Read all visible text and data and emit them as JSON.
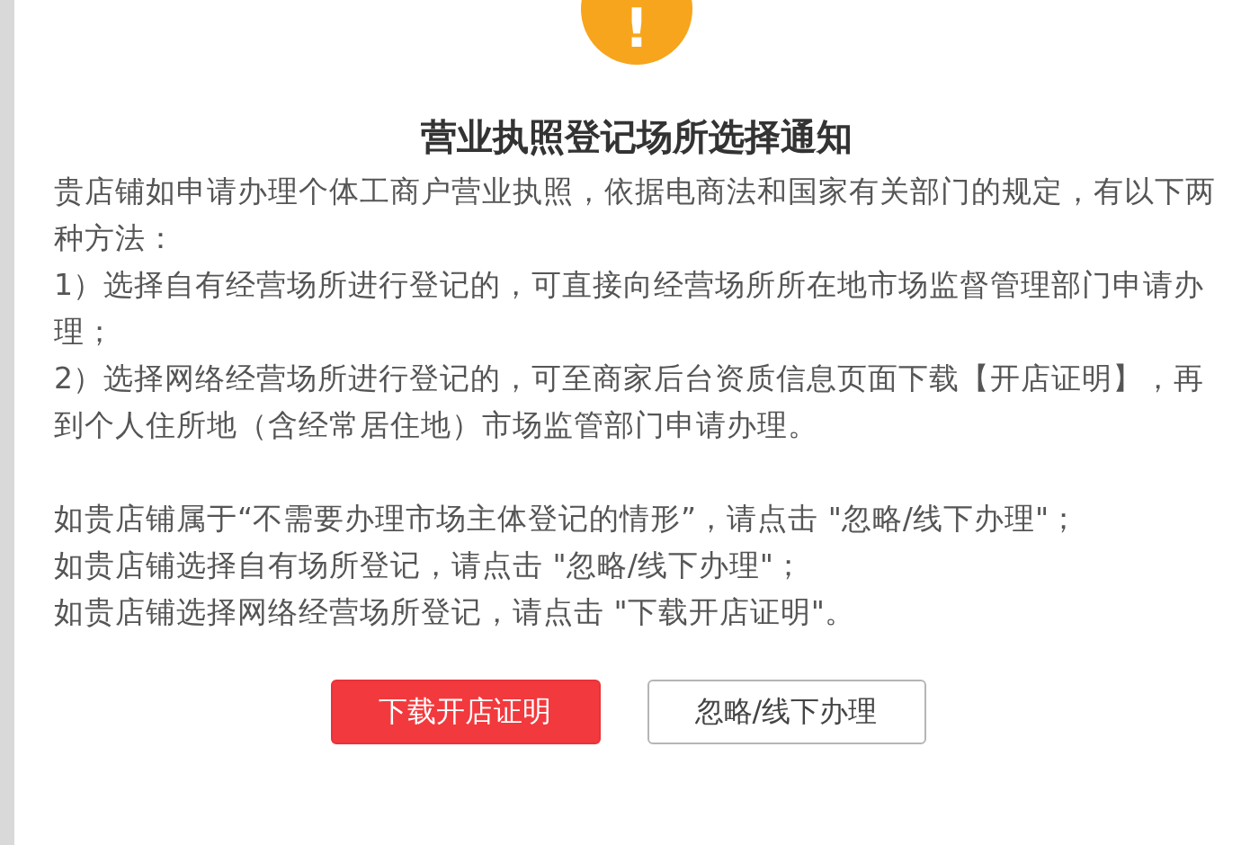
{
  "dialog": {
    "icon_symbol": "!",
    "title": "营业执照登记场所选择通知",
    "paragraphs": [
      "贵店铺如申请办理个体工商户营业执照，依据电商法和国家有关部门的规定，有以下两种方法：",
      "1）选择自有经营场所进行登记的，可直接向经营场所所在地市场监督管理部门申请办理；",
      "2）选择网络经营场所进行登记的，可至商家后台资质信息页面下载【开店证明】，再到个人住所地（含经常居住地）市场监管部门申请办理。"
    ],
    "notes": [
      "如贵店铺属于“不需要办理市场主体登记的情形”，请点击 \"忽略/线下办理\"；",
      "如贵店铺选择自有场所登记，请点击 \"忽略/线下办理\"；",
      "如贵店铺选择网络经营场所登记，请点击 \"下载开店证明\"。"
    ],
    "buttons": [
      {
        "label": "下载开店证明",
        "kind": "primary"
      },
      {
        "label": "忽略/线下办理",
        "kind": "secondary"
      }
    ]
  }
}
